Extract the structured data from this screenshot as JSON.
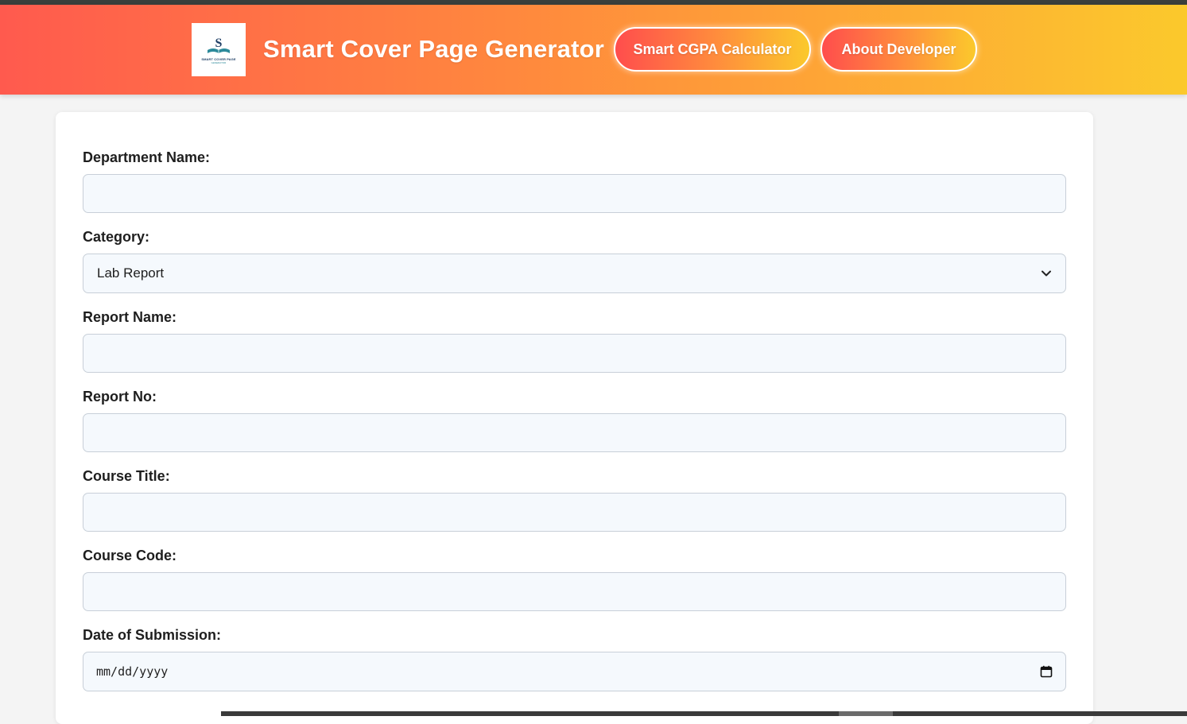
{
  "header": {
    "title": "Smart Cover Page Generator",
    "logo": {
      "icon": "book-logo-icon",
      "line1": "SMART COVER PAGE",
      "line2": "GENERATOR"
    },
    "buttons": {
      "cgpa_label": "Smart CGPA Calculator",
      "developer_label": "About Developer"
    }
  },
  "form": {
    "department": {
      "label": "Department Name:",
      "value": ""
    },
    "category": {
      "label": "Category:",
      "selected": "Lab Report"
    },
    "report_name": {
      "label": "Report Name:",
      "value": ""
    },
    "report_no": {
      "label": "Report No:",
      "value": ""
    },
    "course_title": {
      "label": "Course Title:",
      "value": ""
    },
    "course_code": {
      "label": "Course Code:",
      "value": ""
    },
    "date": {
      "label": "Date of Submission:",
      "placeholder": "mm/dd/yyyy",
      "icon": "calendar-icon"
    }
  },
  "colors": {
    "header_gradient_start": "#ff5a4e",
    "header_gradient_end": "#fbc92c",
    "input_background": "#f5f9fd",
    "page_background": "#f4f4f4"
  }
}
